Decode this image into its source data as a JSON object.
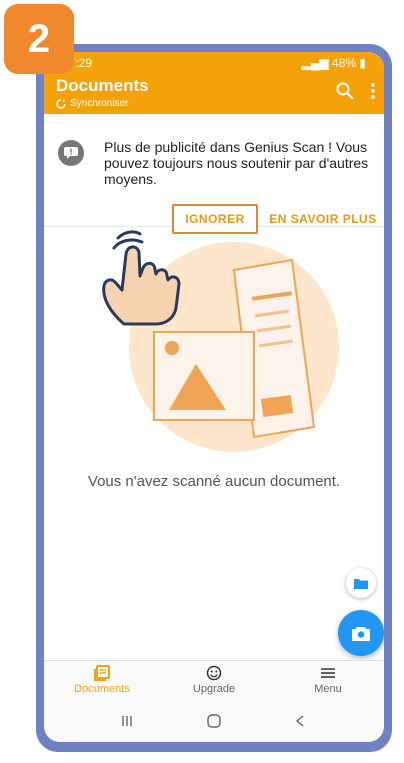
{
  "step": "2",
  "status_bar": {
    "time": "17:29",
    "battery": "48%"
  },
  "app_bar": {
    "title": "Documents",
    "subtitle": "Synchroniser"
  },
  "banner": {
    "message": "Plus de publicité dans Genius Scan ! Vous pouvez toujours nous soutenir par d'autres moyens.",
    "ignore_label": "IGNORER",
    "learn_more_label": "EN SAVOIR PLUS"
  },
  "empty_state": {
    "text": "Vous n'avez scanné aucun document."
  },
  "bottom_nav": {
    "items": [
      {
        "label": "Documents",
        "icon": "documents-icon",
        "active": true
      },
      {
        "label": "Upgrade",
        "icon": "smiley-icon",
        "active": false
      },
      {
        "label": "Menu",
        "icon": "menu-icon",
        "active": false
      }
    ]
  },
  "colors": {
    "accent": "#f5a10a",
    "fab": "#2196f3",
    "frame": "#6f80c3",
    "badge": "#f0892d",
    "highlight": "#e0873a"
  }
}
